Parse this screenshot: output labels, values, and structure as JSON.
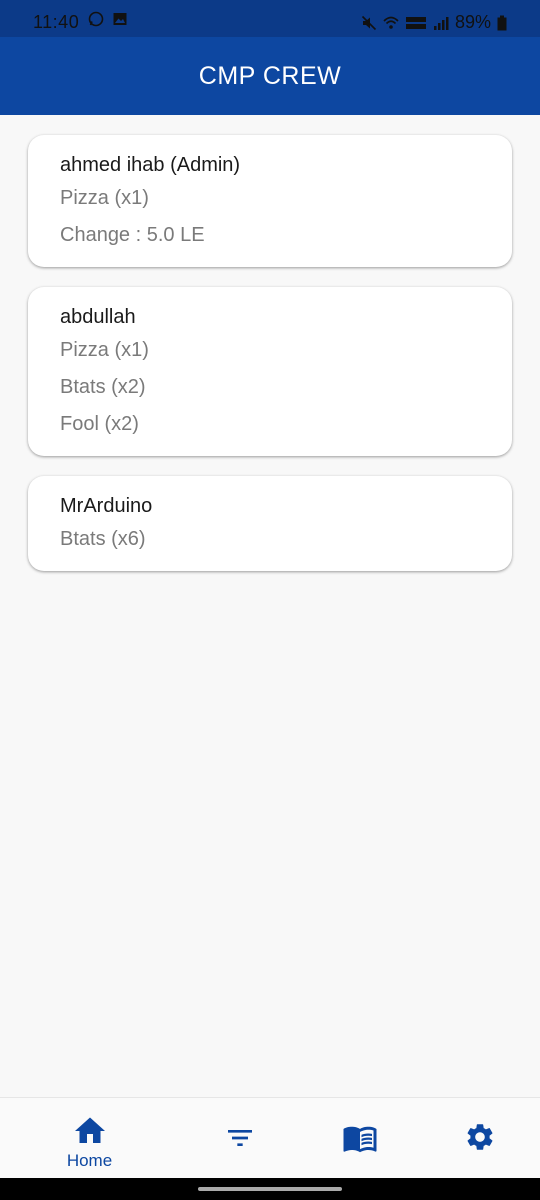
{
  "status_bar": {
    "time": "11:40",
    "battery": "89%"
  },
  "app_bar": {
    "title": "CMP CREW"
  },
  "cards": [
    {
      "name": "ahmed ihab (Admin)",
      "lines": [
        "Pizza (x1)",
        "Change : 5.0 LE"
      ]
    },
    {
      "name": "abdullah",
      "lines": [
        "Pizza (x1)",
        "Btats (x2)",
        "Fool (x2)"
      ]
    },
    {
      "name": "MrArduino",
      "lines": [
        "Btats (x6)"
      ]
    }
  ],
  "bottom_nav": {
    "items": [
      {
        "icon": "home-icon",
        "label": "Home"
      },
      {
        "icon": "filter-icon",
        "label": ""
      },
      {
        "icon": "menu-book-icon",
        "label": ""
      },
      {
        "icon": "settings-icon",
        "label": ""
      }
    ]
  },
  "colors": {
    "primary": "#0d47a1",
    "status_bar": "#0c3a88",
    "background": "#f8f8f8",
    "card": "#ffffff",
    "secondary_text": "#7a7a7a"
  }
}
